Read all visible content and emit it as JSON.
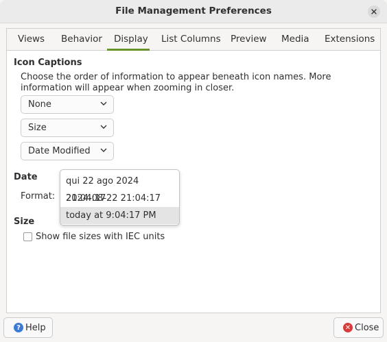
{
  "window": {
    "title": "File Management Preferences"
  },
  "tabs": [
    {
      "label": "Views",
      "active": false
    },
    {
      "label": "Behavior",
      "active": false
    },
    {
      "label": "Display",
      "active": true
    },
    {
      "label": "List Columns",
      "active": false
    },
    {
      "label": "Preview",
      "active": false
    },
    {
      "label": "Media",
      "active": false
    },
    {
      "label": "Extensions",
      "active": false
    }
  ],
  "icon_captions": {
    "heading": "Icon Captions",
    "description": "Choose the order of information to appear beneath icon names. More information will appear when zooming in closer.",
    "combos": [
      "None",
      "Size",
      "Date Modified"
    ]
  },
  "date": {
    "heading": "Date",
    "format_label": "Format:",
    "format_options": [
      "qui 22 ago 2024 21:04:17",
      "2024-08-22 21:04:17",
      "today at 9:04:17 PM"
    ],
    "selected_index": 2
  },
  "size": {
    "heading": "Size",
    "checkbox_label": "Show file sizes with IEC units",
    "checked": false
  },
  "buttons": {
    "help": "Help",
    "close": "Close"
  },
  "colors": {
    "accent": "#68922a",
    "help_icon": "#3b7bd5",
    "close_icon": "#d93a3a"
  },
  "icons": {
    "window_close": "close-icon",
    "help": "help-icon",
    "close": "close-circle-icon",
    "combo": "chevron-down-icon"
  }
}
